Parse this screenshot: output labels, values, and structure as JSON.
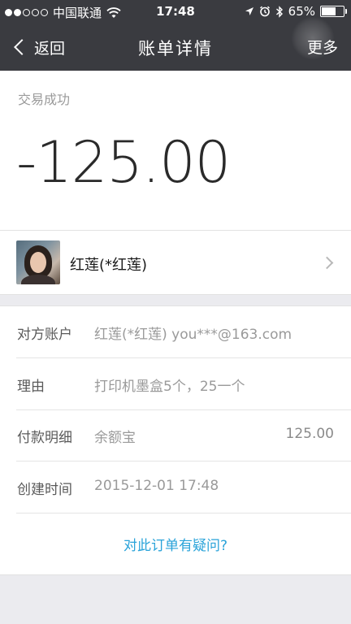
{
  "status_bar": {
    "carrier": "中国联通",
    "time": "17:48",
    "battery": "65%",
    "battery_level": 0.65
  },
  "nav": {
    "back_label": "返回",
    "title": "账单详情",
    "more_label": "更多"
  },
  "transaction": {
    "status": "交易成功",
    "amount": "-125.00"
  },
  "contact": {
    "name": "红莲(*红莲)"
  },
  "details": {
    "counterparty_label": "对方账户",
    "counterparty_value": "红莲(*红莲) you***@163.com",
    "reason_label": "理由",
    "reason_value": "打印机墨盒5个，25一个",
    "payment_label": "付款明细",
    "payment_value": "余额宝",
    "payment_amount": "125.00",
    "created_label": "创建时间",
    "created_value": "2015-12-01 17:48"
  },
  "question_link": "对此订单有疑问?"
}
